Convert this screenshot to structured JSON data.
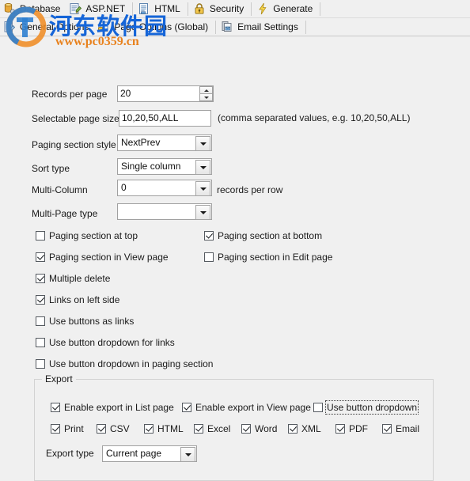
{
  "toolbar_main": {
    "items": [
      {
        "label": "Database",
        "icon": "database-icon"
      },
      {
        "label": "ASP.NET",
        "icon": "aspnet-document-icon"
      },
      {
        "label": "HTML",
        "icon": "html-document-icon"
      },
      {
        "label": "Security",
        "icon": "padlock-icon"
      },
      {
        "label": "Generate",
        "icon": "lightning-bolt-icon"
      }
    ]
  },
  "toolbar_sub": {
    "items": [
      {
        "label": "General Options",
        "icon": "pencil-document-icon"
      },
      {
        "label": "Page Options (Global)",
        "icon": "page-options-icon"
      },
      {
        "label": "Email Settings",
        "icon": "email-settings-icon"
      }
    ]
  },
  "watermark": {
    "text_cn": "河东软件园",
    "url": "www.pc0359.cn"
  },
  "fields": {
    "records_per_page": {
      "label": "Records per page",
      "value": "20"
    },
    "selectable_page_sizes": {
      "label": "Selectable page sizes",
      "value": "10,20,50,ALL",
      "hint": "(comma separated values, e.g. 10,20,50,ALL)"
    },
    "paging_section_style": {
      "label": "Paging section style",
      "value": "NextPrev"
    },
    "sort_type": {
      "label": "Sort type",
      "value": "Single column"
    },
    "multi_column": {
      "label": "Multi-Column",
      "value": "0",
      "suffix": "records per row"
    },
    "multi_page_type": {
      "label": "Multi-Page type",
      "value": ""
    }
  },
  "checkboxes": {
    "paging_top": {
      "label": "Paging section at top",
      "checked": false
    },
    "paging_bottom": {
      "label": "Paging section at bottom",
      "checked": true
    },
    "paging_view": {
      "label": "Paging section in View page",
      "checked": true
    },
    "paging_edit": {
      "label": "Paging section in Edit page",
      "checked": false
    },
    "multiple_delete": {
      "label": "Multiple delete",
      "checked": true
    },
    "links_left": {
      "label": "Links on left side",
      "checked": true
    },
    "buttons_as_links": {
      "label": "Use buttons as links",
      "checked": false
    },
    "dropdown_for_links": {
      "label": "Use button dropdown for links",
      "checked": false
    },
    "dropdown_paging": {
      "label": "Use button dropdown in paging section",
      "checked": false
    }
  },
  "export": {
    "title": "Export",
    "enable_list": {
      "label": "Enable export in List page",
      "checked": true
    },
    "enable_view": {
      "label": "Enable export in View page",
      "checked": true
    },
    "use_dropdown": {
      "label": "Use button dropdown",
      "checked": false
    },
    "formats": [
      {
        "label": "Print",
        "checked": true
      },
      {
        "label": "CSV",
        "checked": true
      },
      {
        "label": "HTML",
        "checked": true
      },
      {
        "label": "Excel",
        "checked": true
      },
      {
        "label": "Word",
        "checked": true
      },
      {
        "label": "XML",
        "checked": true
      },
      {
        "label": "PDF",
        "checked": true
      },
      {
        "label": "Email",
        "checked": true
      }
    ],
    "export_type": {
      "label": "Export type",
      "value": "Current page"
    }
  }
}
